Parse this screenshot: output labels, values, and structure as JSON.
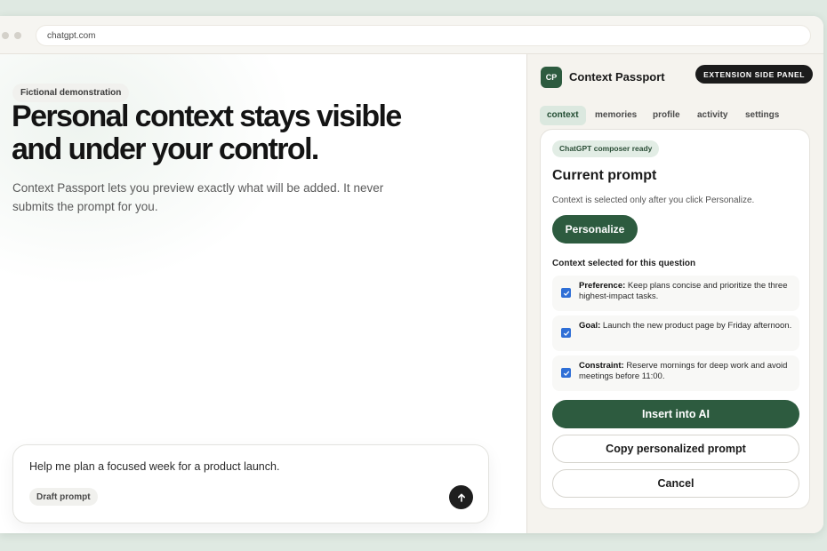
{
  "browser": {
    "url": "chatgpt.com"
  },
  "hero": {
    "tag": "Fictional demonstration",
    "headline_line1": "Personal context stays visible",
    "headline_line2": "and under your control.",
    "subtext": "Context Passport lets you preview exactly what will be added. It never submits the prompt for you."
  },
  "composer": {
    "text": "Help me plan a focused week for a product launch.",
    "draft_label": "Draft prompt",
    "send_icon": "arrow-up-icon"
  },
  "panel": {
    "badge": "CP",
    "title": "Context Passport",
    "extension_label": "EXTENSION SIDE PANEL",
    "tabs": [
      {
        "label": "context",
        "active": true
      },
      {
        "label": "memories",
        "active": false
      },
      {
        "label": "profile",
        "active": false
      },
      {
        "label": "activity",
        "active": false
      },
      {
        "label": "settings",
        "active": false
      }
    ],
    "status": "ChatGPT composer ready",
    "heading": "Current prompt",
    "note": "Context is selected only after you click Personalize.",
    "personalize_label": "Personalize",
    "section_label": "Context selected for this question",
    "items": [
      {
        "label": "Preference:",
        "text": "Keep plans concise and prioritize the three highest-impact tasks.",
        "checked": true
      },
      {
        "label": "Goal:",
        "text": "Launch the new product page by Friday afternoon.",
        "checked": true
      },
      {
        "label": "Constraint:",
        "text": "Reserve mornings for deep work and avoid meetings before 11:00.",
        "checked": true
      }
    ],
    "insert_label": "Insert into AI",
    "copy_label": "Copy personalized prompt",
    "cancel_label": "Cancel"
  },
  "colors": {
    "accent_green": "#2d5b3f",
    "tab_active_bg": "#dbe8df",
    "checkbox_blue": "#2f6fd6",
    "dark": "#1b1b1b"
  }
}
